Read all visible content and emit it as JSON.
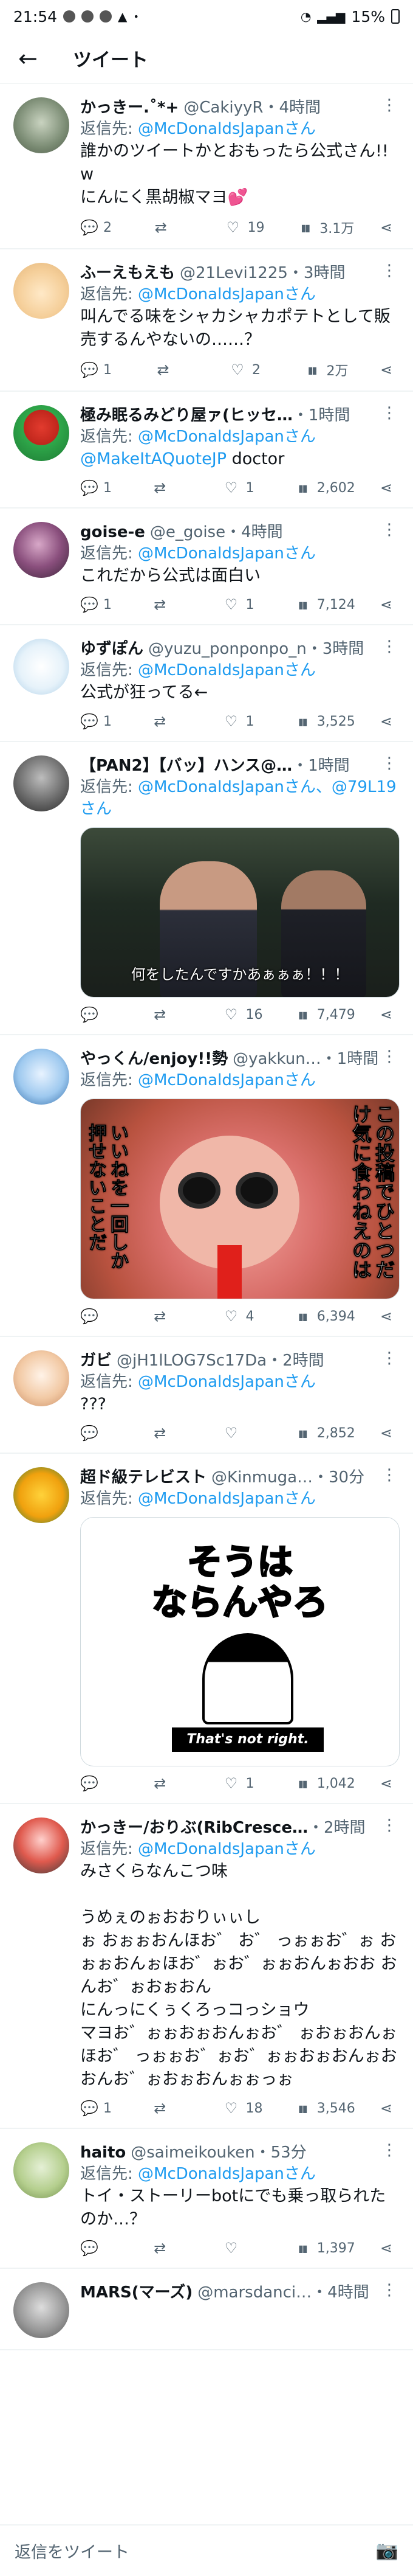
{
  "status": {
    "time": "21:54",
    "battery": "15%"
  },
  "header": {
    "title": "ツイート",
    "back": "←"
  },
  "reply_prefix": "返信先: ",
  "tweets": [
    {
      "name": "かっきー.˚*+",
      "handle": "@CakiyyR",
      "time": "・4時間",
      "reply_to": "@McDonaldsJapanさん",
      "text": "誰かのツイートかとおもったら公式さん!!w\nにんにく黒胡椒マヨ💕",
      "replies": "2",
      "retweets": "",
      "likes": "19",
      "views": "3.1万"
    },
    {
      "name": "ふーえもえも",
      "handle": "@21Levi1225",
      "time": "・3時間",
      "reply_to": "@McDonaldsJapanさん",
      "text": "叫んでる味をシャカシャカポテトとして販売するんやないの……？",
      "replies": "1",
      "retweets": "",
      "likes": "2",
      "views": "2万"
    },
    {
      "name": "極み眠るみどり屋ァ(ヒッセ…",
      "handle": "",
      "time": "・1時間",
      "reply_to": "@McDonaldsJapanさん",
      "text": "@MakeItAQuoteJP doctor",
      "text_link": "@MakeItAQuoteJP",
      "text_rest": " doctor",
      "replies": "1",
      "retweets": "",
      "likes": "1",
      "views": "2,602"
    },
    {
      "name": "goise-e",
      "handle": "@e_goise",
      "time": "・4時間",
      "reply_to": "@McDonaldsJapanさん",
      "text": "これだから公式は面白い",
      "replies": "1",
      "retweets": "",
      "likes": "1",
      "views": "7,124"
    },
    {
      "name": "ゆずぽん",
      "handle": "@yuzu_ponponpo_n",
      "time": "・3時間",
      "reply_to": "@McDonaldsJapanさん",
      "text": "公式が狂ってる←",
      "replies": "1",
      "retweets": "",
      "likes": "1",
      "views": "3,525"
    },
    {
      "name": "【PAN2】【バッ】ハンス@…",
      "handle": "",
      "time": "・1時間",
      "reply_to": "@McDonaldsJapanさん、@79L19さん",
      "text": "",
      "image_caption": "何をしたんですかあぁぁぁ！！！",
      "replies": "",
      "retweets": "",
      "likes": "16",
      "views": "7,479"
    },
    {
      "name": "やっくん/enjoy!!勢",
      "handle": "@yakkun…",
      "time": "・1時間",
      "reply_to": "@McDonaldsJapanさん",
      "text": "",
      "image_text_right": "この投稿でひとつだけ気に食わねえのは",
      "image_text_left": "いいねを一回しか押せないことだ",
      "replies": "",
      "retweets": "",
      "likes": "4",
      "views": "6,394"
    },
    {
      "name": "ガビ",
      "handle": "@jH1lLOG7Sc17Da",
      "time": "・2時間",
      "reply_to": "@McDonaldsJapanさん",
      "text": "???",
      "replies": "",
      "retweets": "",
      "likes": "",
      "views": "2,852"
    },
    {
      "name": "超ド級テレビスト",
      "handle": "@Kinmuga…",
      "time": "・30分",
      "reply_to": "@McDonaldsJapanさん",
      "text": "",
      "image_title": "そうは\nならんやろ",
      "image_sub": "That's not right.",
      "replies": "",
      "retweets": "",
      "likes": "1",
      "views": "1,042"
    },
    {
      "name": "かっきー/おりぶ(RibCresce…",
      "handle": "",
      "time": "・2時間",
      "reply_to": "@McDonaldsJapanさん",
      "text": "みさくらなんこつ味\n\nうめぇのぉおおりぃぃし\nぉ おぉぉおんほお゛ お゛ っぉぉお゛ぉ おぉぉおんぉほお゛ぉお゛ぉぉおんぉおお おんお゛ぉおぉおん\nにんっにくぅくろっコっショウ\nマヨお゛ぉぉおぉおんぉお゛ ぉおぉおんぉほお゛ っぉぉお゛ぉお゛ぉぉおぉおんぉお おんお゛ぉおぉおんぉぉっぉ",
      "replies": "1",
      "retweets": "",
      "likes": "18",
      "views": "3,546"
    },
    {
      "name": "haito",
      "handle": "@saimeikouken",
      "time": "・53分",
      "reply_to": "@McDonaldsJapanさん",
      "text": "トイ・ストーリーbotにでも乗っ取られたのか…？",
      "replies": "",
      "retweets": "",
      "likes": "",
      "views": "1,397"
    },
    {
      "name": "MARS(マーズ)",
      "handle": "@marsdanci…",
      "time": "・4時間",
      "reply_to": "",
      "text": "",
      "replies": "",
      "retweets": "",
      "likes": "",
      "views": ""
    }
  ],
  "bottom": {
    "placeholder": "返信をツイート"
  },
  "colors": {
    "link": "#1d9bf0",
    "muted": "#536471"
  }
}
